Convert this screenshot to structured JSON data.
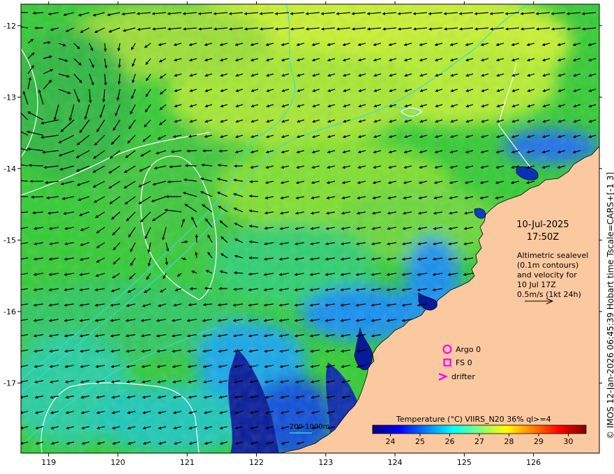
{
  "header": {
    "date": "10-Jul-2025",
    "time": "17:50Z"
  },
  "annotation": {
    "line1": "Altimetric sealevel",
    "line2": "(0.1m contours)",
    "line3": "and velocity for",
    "line4": "10 Jul 17Z",
    "line5": "0.5m/s (1kt 24h)"
  },
  "legend": {
    "argo": "Argo 0",
    "fs": "FS 0",
    "drifter": "drifter",
    "argo_color": "#ff00ff",
    "fs_color": "#ff00ff",
    "drifter_color": "#ff00ff"
  },
  "depth_legend": {
    "label": "200  1000m",
    "color": "#44dddd"
  },
  "colorbar": {
    "title": "Temperature (°C) VIIRS_N20 36% ql>=4",
    "ticks": [
      "24",
      "25",
      "26",
      "27",
      "28",
      "29",
      "30"
    ],
    "range": [
      23.4,
      30.6
    ],
    "stops": [
      "#00007f",
      "#0000ff",
      "#0080ff",
      "#00ffff",
      "#80ff80",
      "#ffff00",
      "#ff8000",
      "#ff0000",
      "#7f0000"
    ]
  },
  "axes": {
    "x_ticks": [
      "119",
      "120",
      "121",
      "122",
      "123",
      "124",
      "125",
      "126"
    ],
    "y_ticks": [
      "-12",
      "-13",
      "-14",
      "-15",
      "-16",
      "-17"
    ],
    "x_range": [
      118.6,
      126.95
    ],
    "y_range": [
      -17.98,
      -11.7
    ]
  },
  "side_note": "© IMOS 12-Jan-2026 06:45:39 Hobart time Tscale=CARS+[-1 3]",
  "colors": {
    "land": "#fbc9a0",
    "coast": "#000000",
    "isobath": "#33dddd",
    "contour": "#ffffff",
    "arrow": "#000000"
  }
}
